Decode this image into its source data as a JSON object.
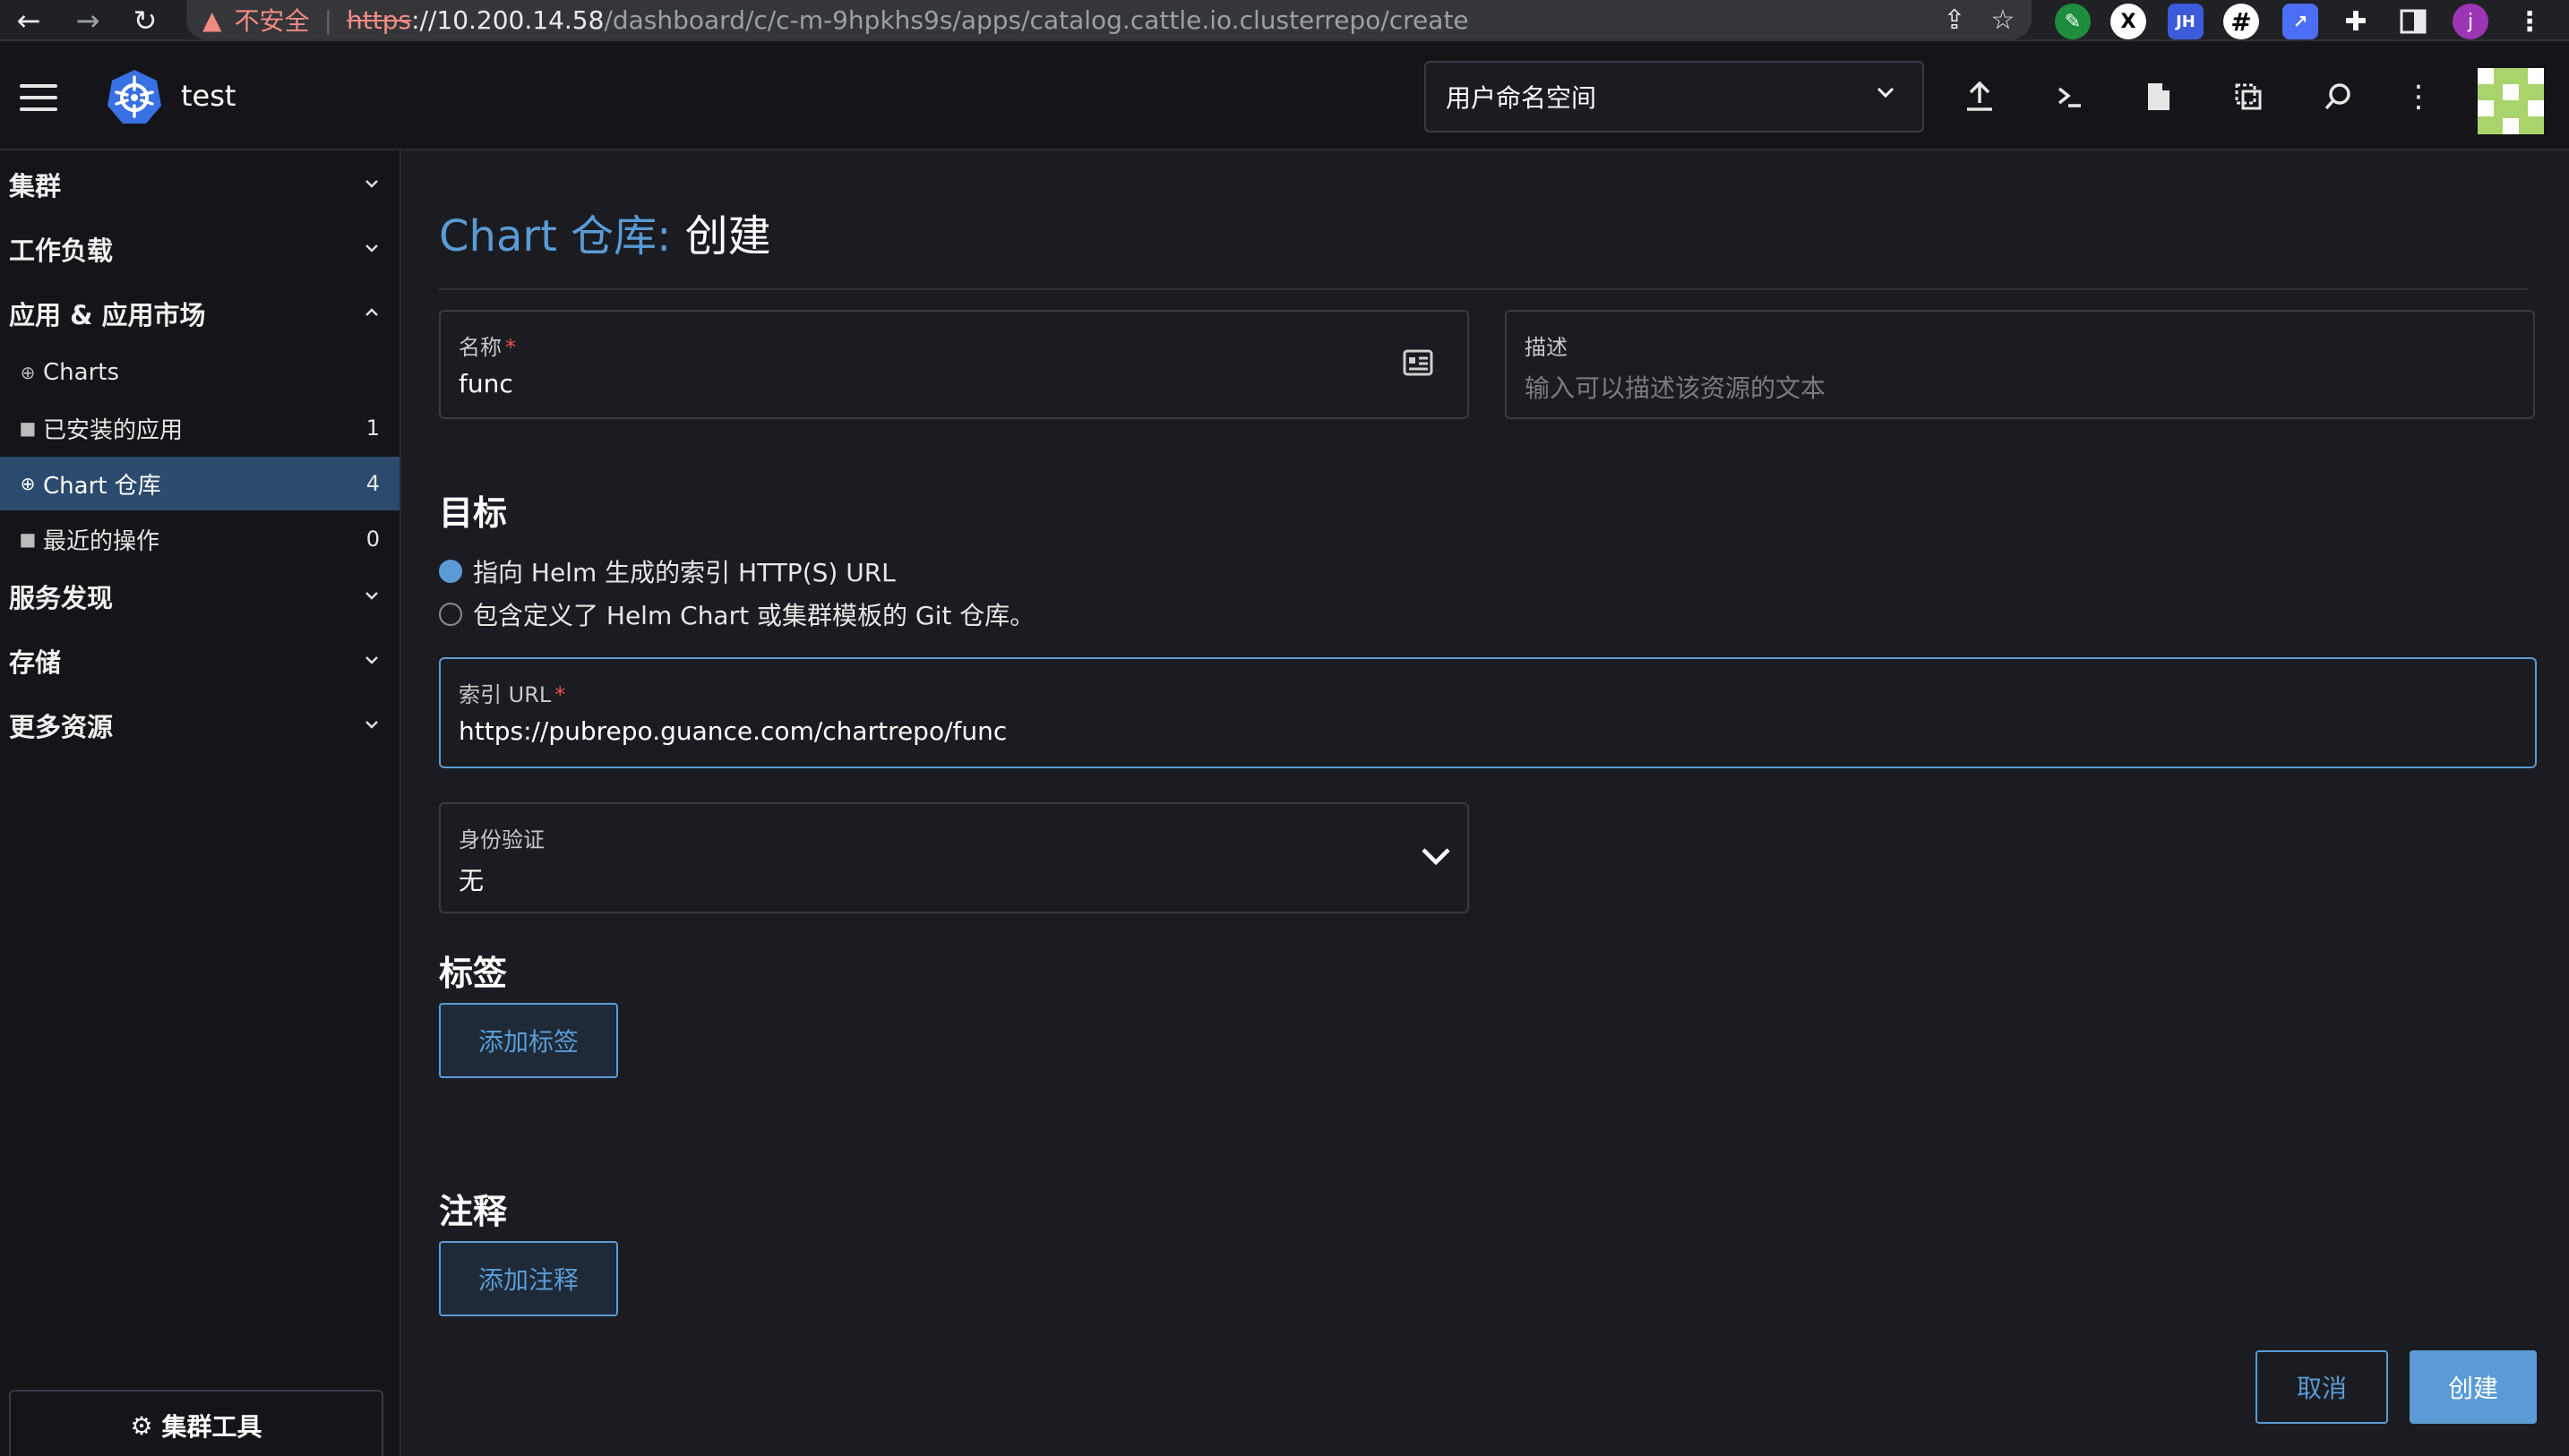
{
  "browser": {
    "security_label": "不安全",
    "url_scheme": "https",
    "url_host": "://10.200.14.58",
    "url_path": "/dashboard/c/c-m-9hpkhs9s/apps/catalog.cattle.io.clusterrepo/create",
    "profile_initial": "j",
    "ext_x": "X",
    "ext_jh": "JH"
  },
  "header": {
    "cluster_name": "test",
    "namespace_select": "用户命名空间"
  },
  "sidebar": {
    "groups": [
      {
        "label": "集群"
      },
      {
        "label": "工作负载"
      },
      {
        "label": "应用 & 应用市场"
      },
      {
        "label": "服务发现"
      },
      {
        "label": "存储"
      },
      {
        "label": "更多资源"
      }
    ],
    "items": [
      {
        "label": "Charts",
        "count": ""
      },
      {
        "label": "已安装的应用",
        "count": "1"
      },
      {
        "label": "Chart 仓库",
        "count": "4"
      },
      {
        "label": "最近的操作",
        "count": "0"
      }
    ],
    "tools_label": "集群工具"
  },
  "main": {
    "title_accent": "Chart 仓库:",
    "title_rest": "创建",
    "name_field": {
      "label": "名称",
      "required": "*",
      "value": "func"
    },
    "desc_field": {
      "label": "描述",
      "placeholder": "输入可以描述该资源的文本"
    },
    "target_heading": "目标",
    "target_options": [
      {
        "label": "指向 Helm 生成的索引 HTTP(S) URL",
        "selected": true
      },
      {
        "label": "包含定义了 Helm Chart 或集群模板的 Git 仓库。",
        "selected": false
      }
    ],
    "index_url": {
      "label": "索引 URL",
      "required": "*",
      "value": "https://pubrepo.guance.com/chartrepo/func"
    },
    "auth": {
      "label": "身份验证",
      "value": "无"
    },
    "labels_heading": "标签",
    "add_label": "添加标签",
    "annotations_heading": "注释",
    "add_annotation": "添加注释",
    "cancel": "取消",
    "create": "创建"
  },
  "colors": {
    "accent": "#5a9bd5",
    "active_nav": "#2a4a6e",
    "required": "#e5544b",
    "warning": "#f28b82"
  }
}
